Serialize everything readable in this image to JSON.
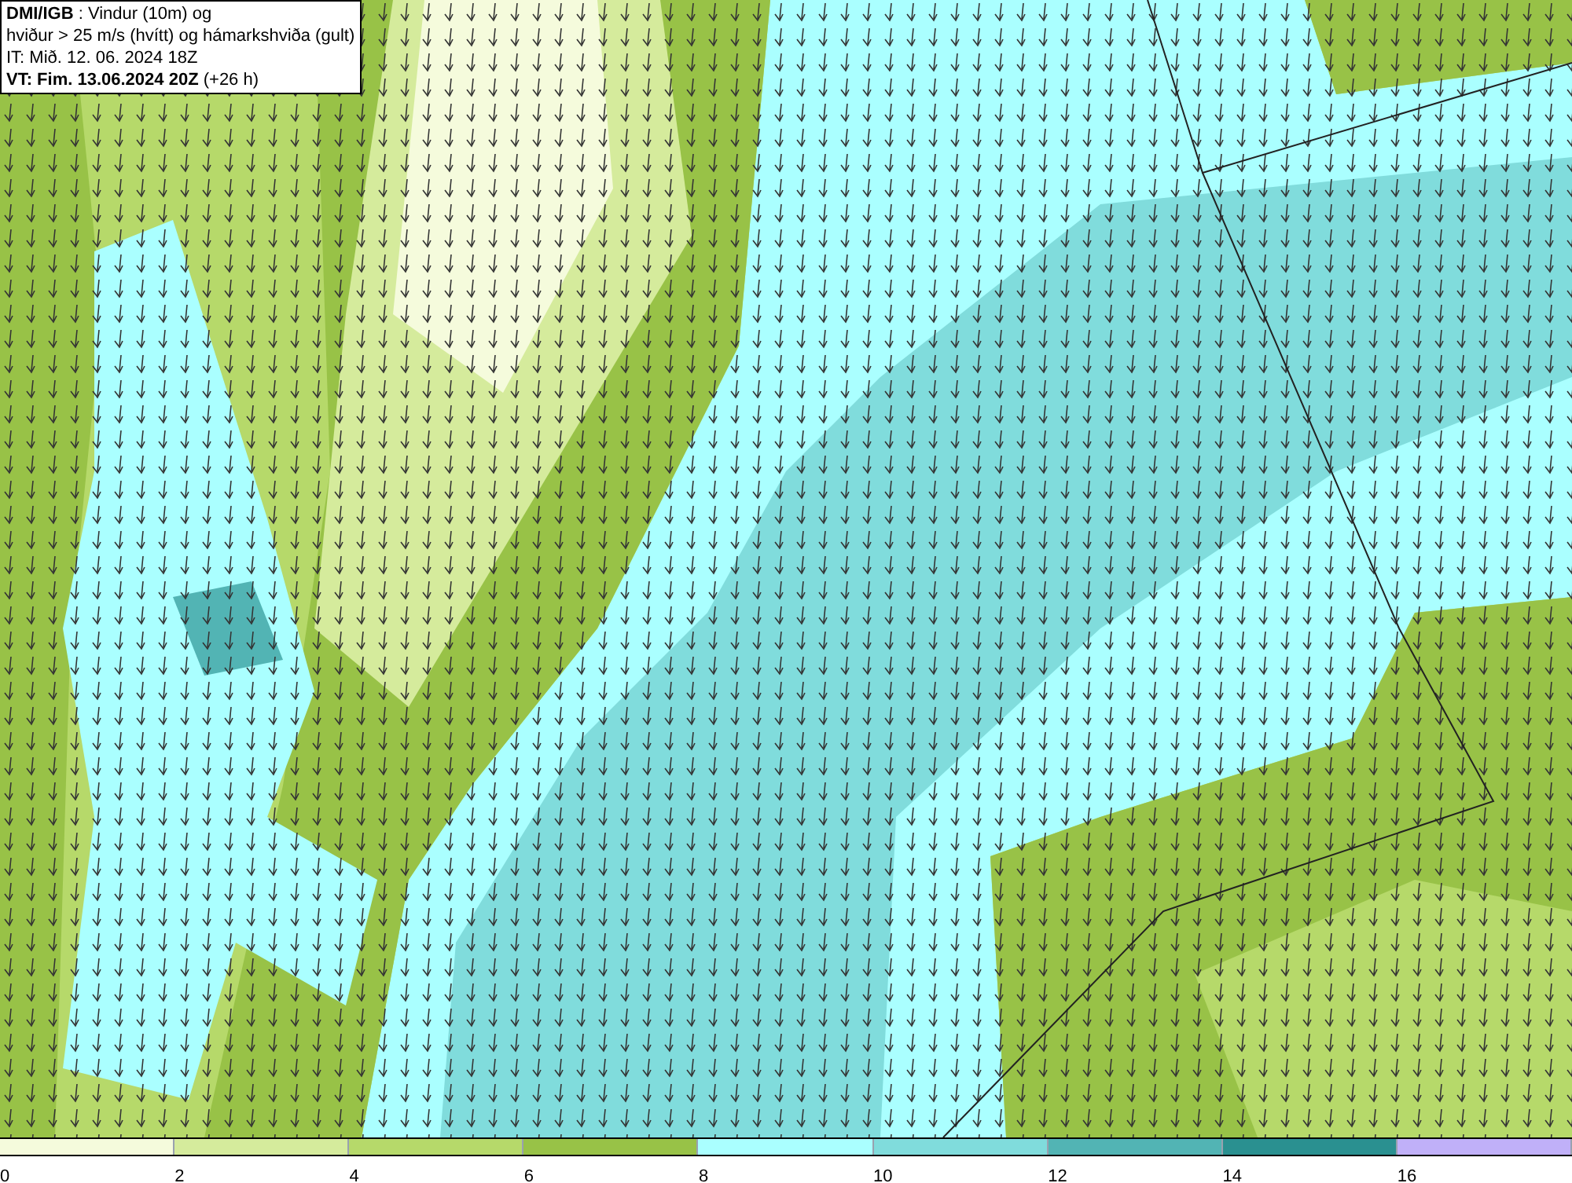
{
  "header": {
    "lines": [
      "**DMI/IGB** : Vindur (10m) og",
      "hviður > 25 m/s (hvítt) og hámarkshviða (gult)",
      "IT: Mið. 12. 06. 2024 18Z",
      "**VT: Fim. 13.06.2024 20Z** (+26 h)"
    ]
  },
  "legend": {
    "bins": [
      {
        "label": "0",
        "color": "#f5fbdc"
      },
      {
        "label": "2",
        "color": "#d5eb9c"
      },
      {
        "label": "4",
        "color": "#b6d96a"
      },
      {
        "label": "6",
        "color": "#98c247"
      },
      {
        "label": "8",
        "color": "#aaffff"
      },
      {
        "label": "10",
        "color": "#80dcdc"
      },
      {
        "label": "12",
        "color": "#52b4b4"
      },
      {
        "label": "14",
        "color": "#2a9090"
      },
      {
        "label": "16",
        "color": "#c0b0f8"
      }
    ]
  }
}
